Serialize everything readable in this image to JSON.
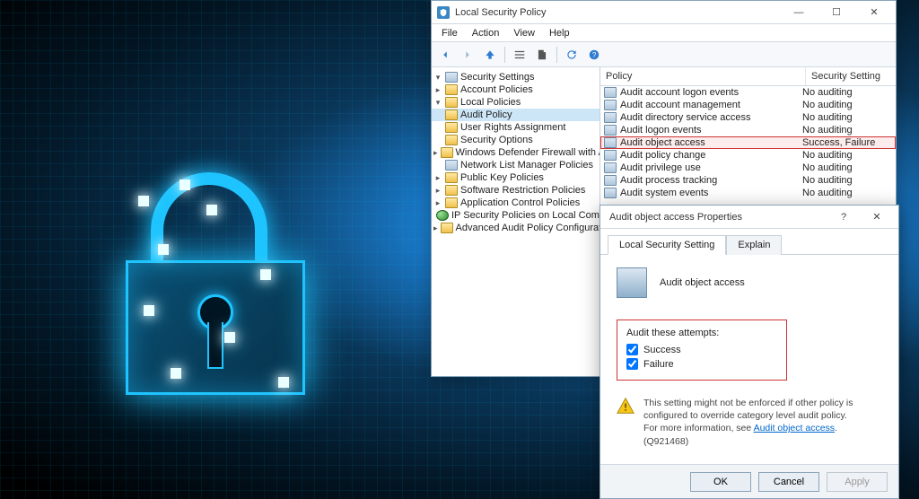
{
  "mmc": {
    "title": "Local Security Policy",
    "menus": [
      "File",
      "Action",
      "View",
      "Help"
    ],
    "tree_root": "Security Settings",
    "tree": [
      {
        "label": "Account Policies",
        "depth": 1,
        "icon": "folder",
        "tw": "▸"
      },
      {
        "label": "Local Policies",
        "depth": 1,
        "icon": "folder",
        "tw": "▾",
        "sel": false
      },
      {
        "label": "Audit Policy",
        "depth": 2,
        "icon": "folder",
        "tw": "",
        "sel": true
      },
      {
        "label": "User Rights Assignment",
        "depth": 2,
        "icon": "folder",
        "tw": ""
      },
      {
        "label": "Security Options",
        "depth": 2,
        "icon": "folder",
        "tw": ""
      },
      {
        "label": "Windows Defender Firewall with Advan",
        "depth": 1,
        "icon": "folder",
        "tw": "▸"
      },
      {
        "label": "Network List Manager Policies",
        "depth": 1,
        "icon": "policy",
        "tw": ""
      },
      {
        "label": "Public Key Policies",
        "depth": 1,
        "icon": "folder",
        "tw": "▸"
      },
      {
        "label": "Software Restriction Policies",
        "depth": 1,
        "icon": "folder",
        "tw": "▸"
      },
      {
        "label": "Application Control Policies",
        "depth": 1,
        "icon": "folder",
        "tw": "▸"
      },
      {
        "label": "IP Security Policies on Local Computer",
        "depth": 1,
        "icon": "globe",
        "tw": ""
      },
      {
        "label": "Advanced Audit Policy Configuration",
        "depth": 1,
        "icon": "folder",
        "tw": "▸"
      }
    ],
    "cols": {
      "policy": "Policy",
      "setting": "Security Setting"
    },
    "rows": [
      {
        "name": "Audit account logon events",
        "value": "No auditing"
      },
      {
        "name": "Audit account management",
        "value": "No auditing"
      },
      {
        "name": "Audit directory service access",
        "value": "No auditing"
      },
      {
        "name": "Audit logon events",
        "value": "No auditing"
      },
      {
        "name": "Audit object access",
        "value": "Success, Failure",
        "hl": true
      },
      {
        "name": "Audit policy change",
        "value": "No auditing"
      },
      {
        "name": "Audit privilege use",
        "value": "No auditing"
      },
      {
        "name": "Audit process tracking",
        "value": "No auditing"
      },
      {
        "name": "Audit system events",
        "value": "No auditing"
      }
    ]
  },
  "dlg": {
    "title": "Audit object access Properties",
    "tab_local": "Local Security Setting",
    "tab_explain": "Explain",
    "object_name": "Audit object access",
    "audit_label": "Audit these attempts:",
    "success": "Success",
    "failure": "Failure",
    "note1": "This setting might not be enforced if other policy is configured to override category level audit policy.",
    "note2a": "For more information, see ",
    "note_link": "Audit object access",
    "note2b": ". (Q921468)",
    "btn_ok": "OK",
    "btn_cancel": "Cancel",
    "btn_apply": "Apply"
  }
}
